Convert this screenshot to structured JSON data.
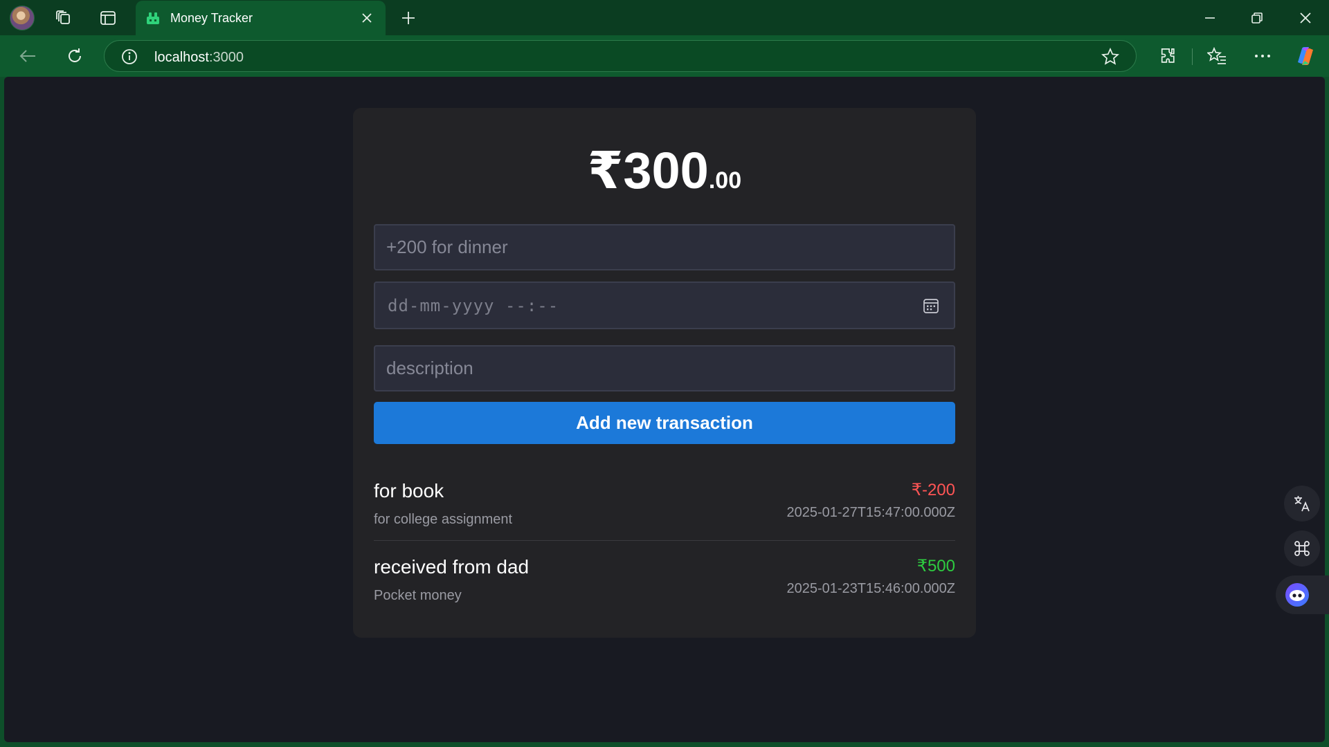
{
  "browser": {
    "tab_title": "Money Tracker",
    "address_host": "localhost",
    "address_port": ":3000"
  },
  "app": {
    "balance_main": "₹300",
    "balance_cents": ".00",
    "amount_placeholder": "+200 for dinner",
    "datetime_placeholder": "dd-mm-yyyy --:--",
    "description_placeholder": "description",
    "add_button_label": "Add new transaction",
    "transactions": [
      {
        "title": "for book",
        "description": "for college assignment",
        "amount": "₹-200",
        "datetime": "2025-01-27T15:47:00.000Z",
        "color": "#ff5555"
      },
      {
        "title": "received from dad",
        "description": "Pocket money",
        "amount": "₹500",
        "datetime": "2025-01-23T15:46:00.000Z",
        "color": "#2ecc40"
      }
    ]
  },
  "colors": {
    "accent": "#1c79d9",
    "negative": "#ff5555",
    "positive": "#2ecc40",
    "chrome": "#0e5a2e",
    "page_bg": "#181a22",
    "card_bg": "#232326"
  },
  "side_buttons": [
    "translate-icon",
    "command-icon",
    "assistant-icon"
  ]
}
